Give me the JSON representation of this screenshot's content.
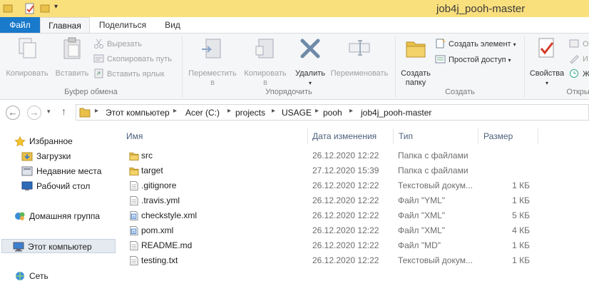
{
  "window": {
    "title": "job4j_pooh-master"
  },
  "tabs": [
    {
      "label": "Файл"
    },
    {
      "label": "Главная"
    },
    {
      "label": "Поделиться"
    },
    {
      "label": "Вид"
    }
  ],
  "ribbon": {
    "clipboard": {
      "copy": "Копировать",
      "paste": "Вставить",
      "cut": "Вырезать",
      "copy_path": "Скопировать путь",
      "paste_shortcut": "Вставить ярлык",
      "group_label": "Буфер обмена"
    },
    "organize": {
      "move_to": "Переместить",
      "move_to_2": "в",
      "copy_to": "Копировать",
      "copy_to_2": "в",
      "delete": "Удалить",
      "rename": "Переименовать",
      "group_label": "Упорядочить"
    },
    "new": {
      "new_folder": "Создать",
      "new_folder_2": "папку",
      "new_item": "Создать элемент",
      "easy_access": "Простой доступ",
      "group_label": "Создать"
    },
    "open": {
      "properties": "Свойства",
      "open_partial": "О",
      "edit_partial": "И",
      "history_partial": "Ж",
      "group_label": "Открыть"
    }
  },
  "address": {
    "crumbs": [
      "Этот компьютер",
      "Acer (C:)",
      "projects",
      "USAGE",
      "pooh",
      "job4j_pooh-master"
    ]
  },
  "nav": {
    "favorites": "Избранное",
    "downloads": "Загрузки",
    "recent": "Недавние места",
    "desktop": "Рабочий стол",
    "homegroup": "Домашняя группа",
    "this_pc": "Этот компьютер",
    "network": "Сеть"
  },
  "columns": {
    "name": "Имя",
    "date": "Дата изменения",
    "type": "Тип",
    "size": "Размер"
  },
  "files": [
    {
      "name": "src",
      "date": "26.12.2020 12:22",
      "type": "Папка с файлами",
      "size": "",
      "icon": "folder-icon"
    },
    {
      "name": "target",
      "date": "27.12.2020 15:39",
      "type": "Папка с файлами",
      "size": "",
      "icon": "folder-icon"
    },
    {
      "name": ".gitignore",
      "date": "26.12.2020 12:22",
      "type": "Текстовый докум...",
      "size": "1 КБ",
      "icon": "text-file-icon"
    },
    {
      "name": ".travis.yml",
      "date": "26.12.2020 12:22",
      "type": "Файл \"YML\"",
      "size": "1 КБ",
      "icon": "text-file-icon"
    },
    {
      "name": "checkstyle.xml",
      "date": "26.12.2020 12:22",
      "type": "Файл \"XML\"",
      "size": "5 КБ",
      "icon": "xml-file-icon"
    },
    {
      "name": "pom.xml",
      "date": "26.12.2020 12:22",
      "type": "Файл \"XML\"",
      "size": "4 КБ",
      "icon": "xml-file-icon"
    },
    {
      "name": "README.md",
      "date": "26.12.2020 12:22",
      "type": "Файл \"MD\"",
      "size": "1 КБ",
      "icon": "text-file-icon"
    },
    {
      "name": "testing.txt",
      "date": "26.12.2020 12:22",
      "type": "Текстовый докум...",
      "size": "1 КБ",
      "icon": "text-file-icon"
    }
  ],
  "colors": {
    "accent": "#1979ca",
    "titlebar": "#fadf7d",
    "folder": "#e8c04a"
  }
}
